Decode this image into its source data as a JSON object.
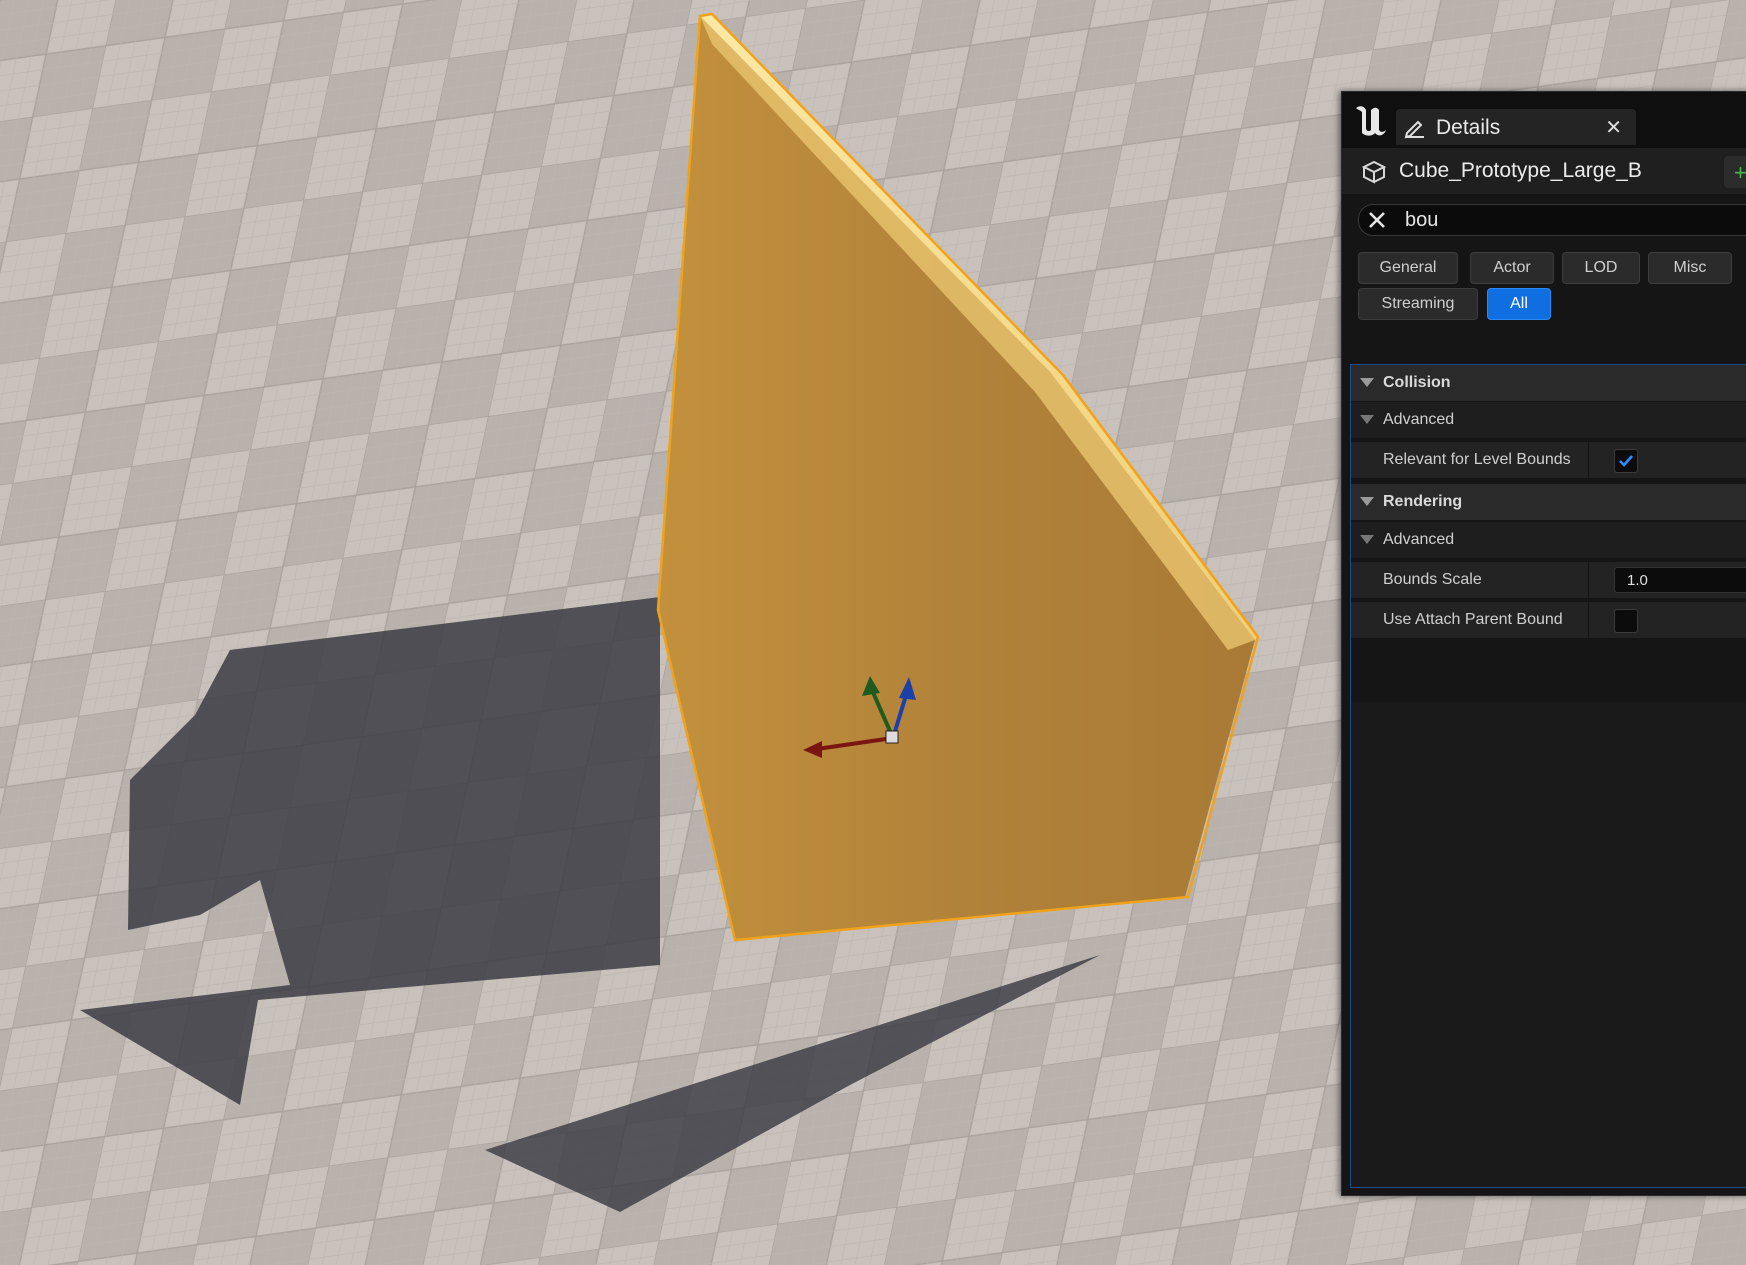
{
  "window": {
    "tab_title": "Details",
    "tab_close": "✕"
  },
  "actor": {
    "name": "Cube_Prototype_Large_B",
    "add_label": "+"
  },
  "search": {
    "value": "bou"
  },
  "filters": [
    "General",
    "Actor",
    "LOD",
    "Misc",
    "Streaming",
    "All"
  ],
  "active_filter": "All",
  "sections": {
    "collision": {
      "label": "Collision",
      "advanced_label": "Advanced",
      "relevant_for_level_bounds": {
        "label": "Relevant for Level Bounds",
        "checked": true
      }
    },
    "rendering": {
      "label": "Rendering",
      "advanced_label": "Advanced",
      "bounds_scale": {
        "label": "Bounds Scale",
        "value": "1.0"
      },
      "use_attach_parent_bound": {
        "label": "Use Attach Parent Bound",
        "checked": false
      }
    }
  },
  "colors": {
    "accent": "#0f6fe0",
    "selection_outline": "#f0a21a",
    "mesh": "#b8893a"
  }
}
